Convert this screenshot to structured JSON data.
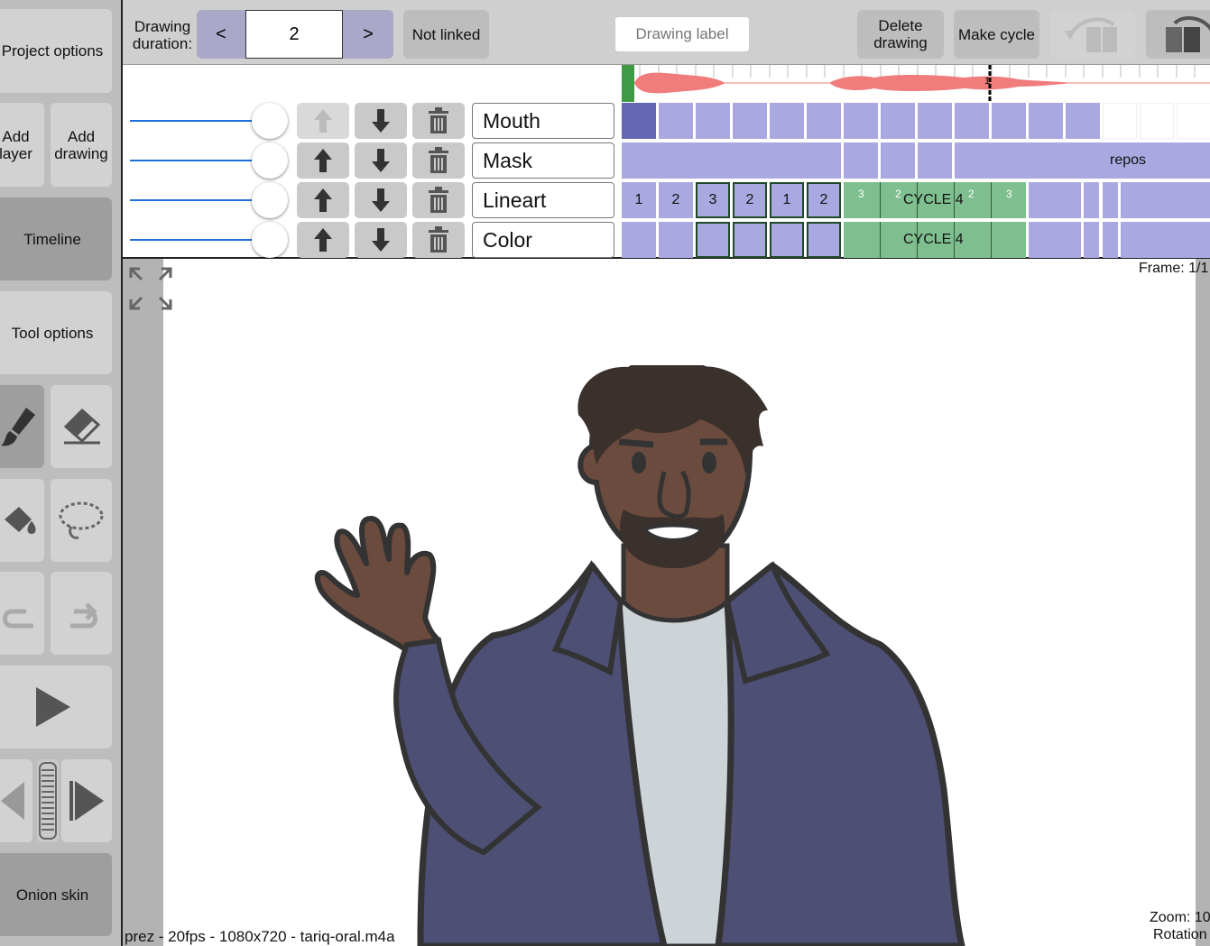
{
  "sidebar": {
    "project_options": "Project options",
    "add_layer": "Add layer",
    "add_drawing": "Add drawing",
    "timeline": "Timeline",
    "tool_options": "Tool options",
    "onion_skin": "Onion skin"
  },
  "topbar": {
    "duration_label": "Drawing duration:",
    "prev": "<",
    "duration_value": "2",
    "next": ">",
    "not_linked": "Not linked",
    "drawing_label_placeholder": "Drawing label",
    "delete_drawing": "Delete drawing",
    "make_cycle": "Make cycle"
  },
  "layers": [
    {
      "name": "Mouth"
    },
    {
      "name": "Mask"
    },
    {
      "name": "Lineart"
    },
    {
      "name": "Color"
    }
  ],
  "timeline": {
    "audio_marker": "1",
    "mask_label": "repos",
    "lineart_cells": [
      "1",
      "2",
      "3",
      "2",
      "1",
      "2"
    ],
    "cycle_label": "CYCLE 4",
    "cycle_small": [
      "3",
      "2",
      "2",
      "3"
    ]
  },
  "canvas": {
    "frame": "Frame: 1/1",
    "zoom": "Zoom: 10",
    "rotation": "Rotation",
    "status": "prez - 20fps - 1080x720 - tariq-oral.m4a"
  },
  "colors": {
    "cell_purple": "#a9a8e0",
    "cell_green": "#7fbf8f",
    "waveform": "#f07c7c",
    "slider_blue": "#1e6fd9"
  }
}
